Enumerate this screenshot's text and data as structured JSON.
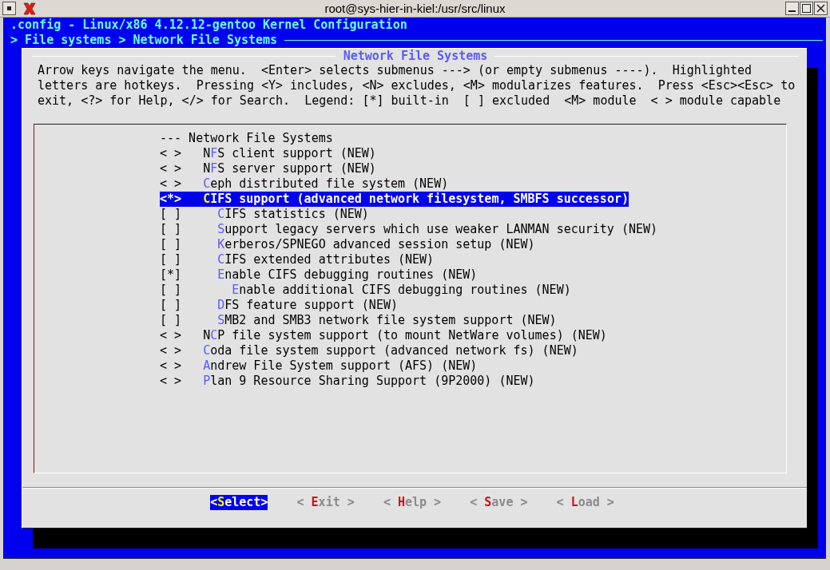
{
  "window": {
    "title": "root@sys-hier-in-kiel:/usr/src/linux"
  },
  "heading": ".config - Linux/x86 4.12.12-gentoo Kernel Configuration",
  "breadcrumb": "> File systems > Network File Systems",
  "dialog": {
    "title": "Network File Systems",
    "help": "Arrow keys navigate the menu.  <Enter> selects submenus ---> (or empty submenus ----).  Highlighted\nletters are hotkeys.  Pressing <Y> includes, <N> excludes, <M> modularizes features.  Press <Esc><Esc> to\nexit, <?> for Help, </> for Search.  Legend: [*] built-in  [ ] excluded  <M> module  < > module capable",
    "menu": [
      {
        "kind": "comment",
        "label": "--- Network File Systems",
        "selected": false
      },
      {
        "kind": "option",
        "marker": "< >",
        "label": "N**F**S client support (NEW)",
        "selected": false
      },
      {
        "kind": "option",
        "marker": "< >",
        "label": "N**F**S server support (NEW)",
        "selected": false
      },
      {
        "kind": "option",
        "marker": "< >",
        "label": "**C**eph distributed file system (NEW)",
        "selected": false
      },
      {
        "kind": "option",
        "marker": "<*>",
        "label": "**C**IFS support (advanced network filesystem, SMBFS successor)",
        "selected": true,
        "children": [
          {
            "kind": "option",
            "marker": "[ ]",
            "label": "**C**IFS statistics (NEW)",
            "selected": false
          },
          {
            "kind": "option",
            "marker": "[ ]",
            "label": "**S**upport legacy servers which use weaker LANMAN security (NEW)",
            "selected": false
          },
          {
            "kind": "option",
            "marker": "[ ]",
            "label": "**K**erberos/SPNEGO advanced session setup (NEW)",
            "selected": false
          },
          {
            "kind": "option",
            "marker": "[ ]",
            "label": "**C**IFS extended attributes (NEW)",
            "selected": false
          },
          {
            "kind": "option",
            "marker": "[*]",
            "label": "**E**nable CIFS debugging routines (NEW)",
            "selected": false,
            "children": [
              {
                "kind": "option",
                "marker": "[ ]",
                "label": "**E**nable additional CIFS debugging routines (NEW)",
                "selected": false
              }
            ]
          },
          {
            "kind": "option",
            "marker": "[ ]",
            "label": "**D**FS feature support (NEW)",
            "selected": false
          },
          {
            "kind": "option",
            "marker": "[ ]",
            "label": "**S**MB2 and SMB3 network file system support (NEW)",
            "selected": false
          }
        ]
      },
      {
        "kind": "option",
        "marker": "< >",
        "label": "N**C**P file system support (to mount NetWare volumes) (NEW)",
        "selected": false
      },
      {
        "kind": "option",
        "marker": "< >",
        "label": "**C**oda file system support (advanced network fs) (NEW)",
        "selected": false
      },
      {
        "kind": "option",
        "marker": "< >",
        "label": "**A**ndrew File System support (AFS) (NEW)",
        "selected": false
      },
      {
        "kind": "option",
        "marker": "< >",
        "label": "**P**lan 9 Resource Sharing Support (9P2000) (NEW)",
        "selected": false
      }
    ],
    "buttons": [
      {
        "label": "<**S**elect>",
        "selected": true
      },
      {
        "label": "< **E**xit >",
        "selected": false
      },
      {
        "label": "< **H**elp >",
        "selected": false
      },
      {
        "label": "< **S**ave >",
        "selected": false
      },
      {
        "label": "< **L**oad >",
        "selected": false
      }
    ]
  }
}
